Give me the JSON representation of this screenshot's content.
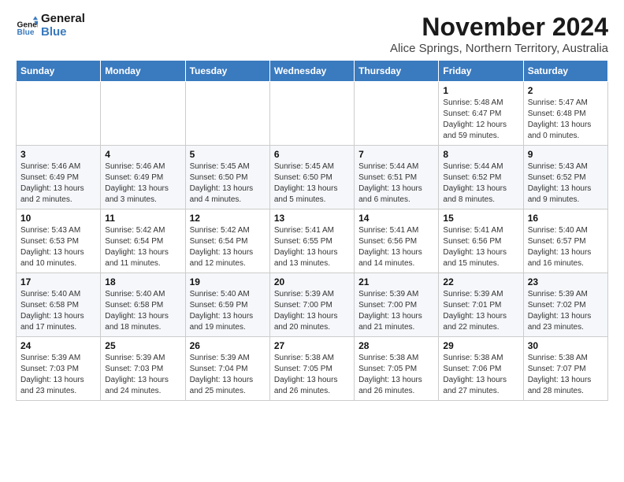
{
  "logo": {
    "line1": "General",
    "line2": "Blue"
  },
  "title": "November 2024",
  "location": "Alice Springs, Northern Territory, Australia",
  "weekdays": [
    "Sunday",
    "Monday",
    "Tuesday",
    "Wednesday",
    "Thursday",
    "Friday",
    "Saturday"
  ],
  "weeks": [
    [
      {
        "day": "",
        "info": ""
      },
      {
        "day": "",
        "info": ""
      },
      {
        "day": "",
        "info": ""
      },
      {
        "day": "",
        "info": ""
      },
      {
        "day": "",
        "info": ""
      },
      {
        "day": "1",
        "info": "Sunrise: 5:48 AM\nSunset: 6:47 PM\nDaylight: 12 hours\nand 59 minutes."
      },
      {
        "day": "2",
        "info": "Sunrise: 5:47 AM\nSunset: 6:48 PM\nDaylight: 13 hours\nand 0 minutes."
      }
    ],
    [
      {
        "day": "3",
        "info": "Sunrise: 5:46 AM\nSunset: 6:49 PM\nDaylight: 13 hours\nand 2 minutes."
      },
      {
        "day": "4",
        "info": "Sunrise: 5:46 AM\nSunset: 6:49 PM\nDaylight: 13 hours\nand 3 minutes."
      },
      {
        "day": "5",
        "info": "Sunrise: 5:45 AM\nSunset: 6:50 PM\nDaylight: 13 hours\nand 4 minutes."
      },
      {
        "day": "6",
        "info": "Sunrise: 5:45 AM\nSunset: 6:50 PM\nDaylight: 13 hours\nand 5 minutes."
      },
      {
        "day": "7",
        "info": "Sunrise: 5:44 AM\nSunset: 6:51 PM\nDaylight: 13 hours\nand 6 minutes."
      },
      {
        "day": "8",
        "info": "Sunrise: 5:44 AM\nSunset: 6:52 PM\nDaylight: 13 hours\nand 8 minutes."
      },
      {
        "day": "9",
        "info": "Sunrise: 5:43 AM\nSunset: 6:52 PM\nDaylight: 13 hours\nand 9 minutes."
      }
    ],
    [
      {
        "day": "10",
        "info": "Sunrise: 5:43 AM\nSunset: 6:53 PM\nDaylight: 13 hours\nand 10 minutes."
      },
      {
        "day": "11",
        "info": "Sunrise: 5:42 AM\nSunset: 6:54 PM\nDaylight: 13 hours\nand 11 minutes."
      },
      {
        "day": "12",
        "info": "Sunrise: 5:42 AM\nSunset: 6:54 PM\nDaylight: 13 hours\nand 12 minutes."
      },
      {
        "day": "13",
        "info": "Sunrise: 5:41 AM\nSunset: 6:55 PM\nDaylight: 13 hours\nand 13 minutes."
      },
      {
        "day": "14",
        "info": "Sunrise: 5:41 AM\nSunset: 6:56 PM\nDaylight: 13 hours\nand 14 minutes."
      },
      {
        "day": "15",
        "info": "Sunrise: 5:41 AM\nSunset: 6:56 PM\nDaylight: 13 hours\nand 15 minutes."
      },
      {
        "day": "16",
        "info": "Sunrise: 5:40 AM\nSunset: 6:57 PM\nDaylight: 13 hours\nand 16 minutes."
      }
    ],
    [
      {
        "day": "17",
        "info": "Sunrise: 5:40 AM\nSunset: 6:58 PM\nDaylight: 13 hours\nand 17 minutes."
      },
      {
        "day": "18",
        "info": "Sunrise: 5:40 AM\nSunset: 6:58 PM\nDaylight: 13 hours\nand 18 minutes."
      },
      {
        "day": "19",
        "info": "Sunrise: 5:40 AM\nSunset: 6:59 PM\nDaylight: 13 hours\nand 19 minutes."
      },
      {
        "day": "20",
        "info": "Sunrise: 5:39 AM\nSunset: 7:00 PM\nDaylight: 13 hours\nand 20 minutes."
      },
      {
        "day": "21",
        "info": "Sunrise: 5:39 AM\nSunset: 7:00 PM\nDaylight: 13 hours\nand 21 minutes."
      },
      {
        "day": "22",
        "info": "Sunrise: 5:39 AM\nSunset: 7:01 PM\nDaylight: 13 hours\nand 22 minutes."
      },
      {
        "day": "23",
        "info": "Sunrise: 5:39 AM\nSunset: 7:02 PM\nDaylight: 13 hours\nand 23 minutes."
      }
    ],
    [
      {
        "day": "24",
        "info": "Sunrise: 5:39 AM\nSunset: 7:03 PM\nDaylight: 13 hours\nand 23 minutes."
      },
      {
        "day": "25",
        "info": "Sunrise: 5:39 AM\nSunset: 7:03 PM\nDaylight: 13 hours\nand 24 minutes."
      },
      {
        "day": "26",
        "info": "Sunrise: 5:39 AM\nSunset: 7:04 PM\nDaylight: 13 hours\nand 25 minutes."
      },
      {
        "day": "27",
        "info": "Sunrise: 5:38 AM\nSunset: 7:05 PM\nDaylight: 13 hours\nand 26 minutes."
      },
      {
        "day": "28",
        "info": "Sunrise: 5:38 AM\nSunset: 7:05 PM\nDaylight: 13 hours\nand 26 minutes."
      },
      {
        "day": "29",
        "info": "Sunrise: 5:38 AM\nSunset: 7:06 PM\nDaylight: 13 hours\nand 27 minutes."
      },
      {
        "day": "30",
        "info": "Sunrise: 5:38 AM\nSunset: 7:07 PM\nDaylight: 13 hours\nand 28 minutes."
      }
    ]
  ]
}
